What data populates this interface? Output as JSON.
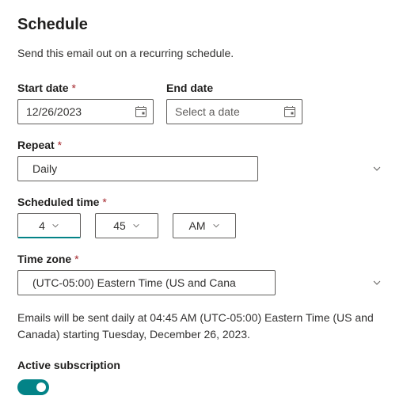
{
  "title": "Schedule",
  "description": "Send this email out on a recurring schedule.",
  "startDate": {
    "label": "Start date",
    "required": "*",
    "value": "12/26/2023"
  },
  "endDate": {
    "label": "End date",
    "placeholder": "Select a date"
  },
  "repeat": {
    "label": "Repeat",
    "required": "*",
    "value": "Daily"
  },
  "scheduledTime": {
    "label": "Scheduled time",
    "required": "*",
    "hour": "4",
    "minute": "45",
    "ampm": "AM"
  },
  "timezone": {
    "label": "Time zone",
    "required": "*",
    "value": "(UTC-05:00) Eastern Time (US and Cana"
  },
  "summary": "Emails will be sent daily at 04:45 AM (UTC-05:00) Eastern Time (US and Canada) starting Tuesday, December 26, 2023.",
  "activeSubscription": {
    "label": "Active subscription",
    "on": true
  }
}
